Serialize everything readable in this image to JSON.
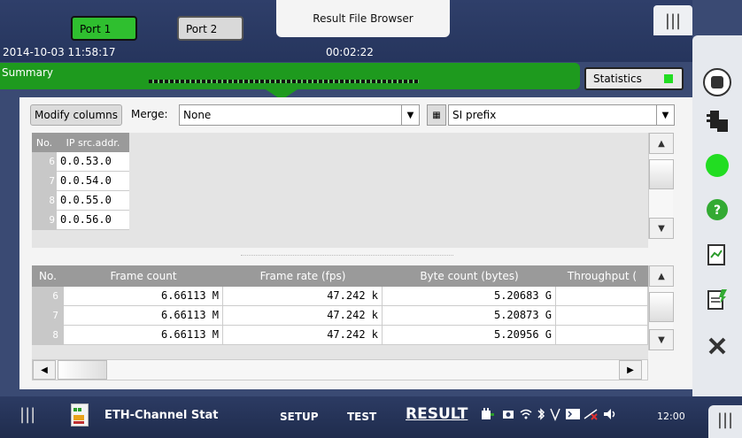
{
  "header": {
    "port1": "Port 1",
    "port2": "Port 2",
    "center_tab": "Result File Browser",
    "datetime": "2014-10-03 11:58:17",
    "elapsed": "00:02:22",
    "summary": "Summary",
    "statistics": "Statistics",
    "colors": {
      "accent_green": "#1e9a1e",
      "led": "#22dd22"
    }
  },
  "toolbar": {
    "modify_columns": "Modify columns",
    "merge_label": "Merge:",
    "merge_value": "None",
    "si_value": "SI prefix",
    "si_icon": "grid-icon"
  },
  "upper_table": {
    "headers": [
      "No.",
      "IP src.addr."
    ],
    "rows": [
      {
        "no": "6",
        "ip": "0.0.53.0"
      },
      {
        "no": "7",
        "ip": "0.0.54.0"
      },
      {
        "no": "8",
        "ip": "0.0.55.0"
      },
      {
        "no": "9",
        "ip": "0.0.56.0"
      }
    ]
  },
  "lower_table": {
    "headers": [
      "No.",
      "Frame count",
      "Frame rate (fps)",
      "Byte count (bytes)",
      "Throughput ("
    ],
    "rows": [
      {
        "no": "6",
        "frame_count": "6.66113 M",
        "frame_rate": "47.242 k",
        "byte_count": "5.20683 G",
        "throughput": ""
      },
      {
        "no": "7",
        "frame_count": "6.66113 M",
        "frame_rate": "47.242 k",
        "byte_count": "5.20873 G",
        "throughput": ""
      },
      {
        "no": "8",
        "frame_count": "6.66113 M",
        "frame_rate": "47.242 k",
        "byte_count": "5.20956 G",
        "throughput": ""
      }
    ]
  },
  "sidebar": {
    "icons": [
      "stop-icon",
      "traffic-light-icon",
      "status-led-icon",
      "help-icon",
      "report-icon",
      "edit-report-icon",
      "close-icon"
    ]
  },
  "bottom": {
    "app_name": "ETH-Channel Stat",
    "setup": "SETUP",
    "test": "TEST",
    "result": "RESULT",
    "clock": "12:00"
  }
}
